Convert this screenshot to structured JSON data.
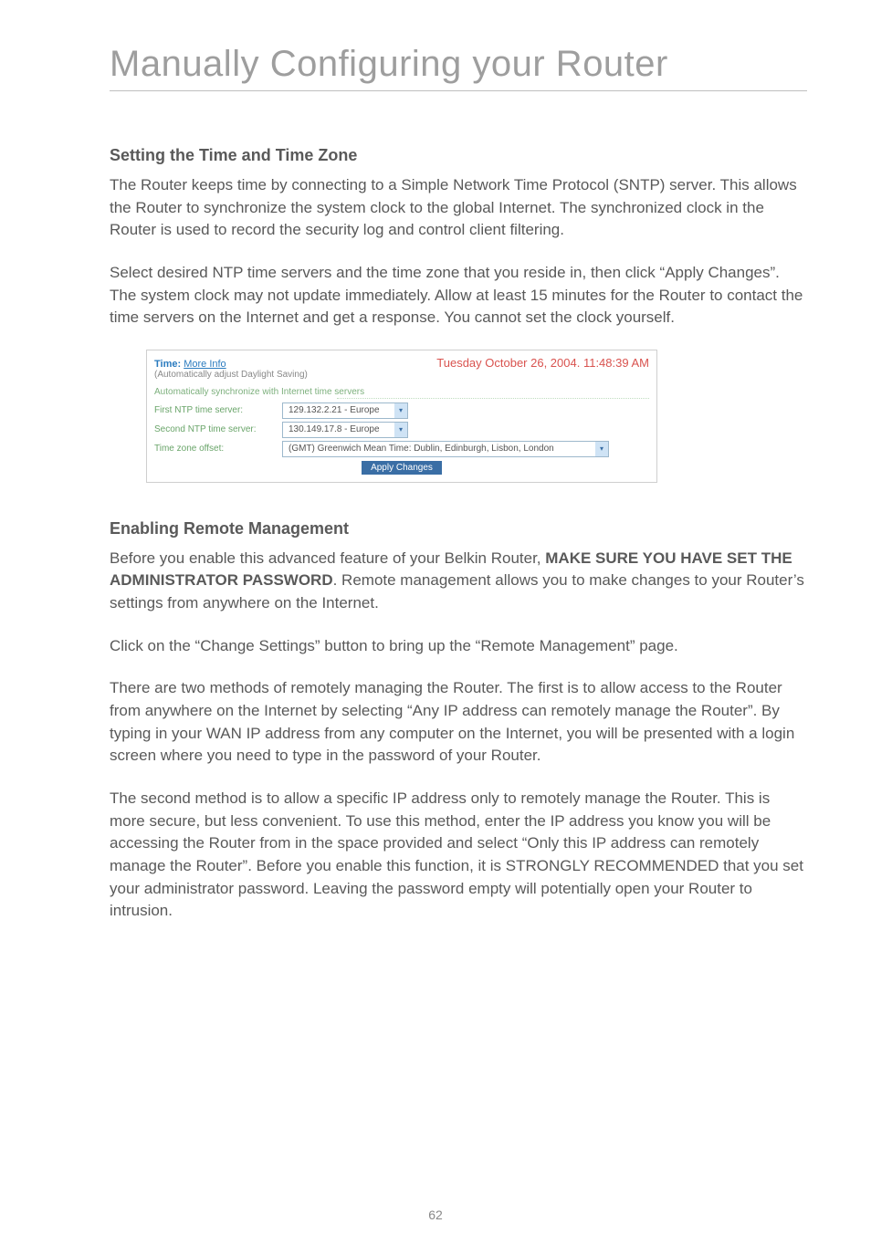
{
  "chapter_title": "Manually Configuring your Router",
  "section1": {
    "heading": "Setting the Time and Time Zone",
    "para1": "The Router keeps time by connecting to a Simple Network Time Protocol (SNTP) server. This allows the Router to synchronize the system clock to the global Internet. The synchronized clock in the Router is used to record the security log and control client filtering.",
    "para2": "Select desired NTP time servers and the time zone that you reside in, then click “Apply Changes”. The system clock may not update immediately. Allow at least 15 minutes for the Router to contact the time servers on the Internet and get a response. You cannot set the clock yourself."
  },
  "embed": {
    "time_label": "Time:",
    "more_info": "More Info",
    "adjust_note": "(Automatically adjust Daylight Saving)",
    "clock_text": "Tuesday October 26, 2004. 11:48:39 AM",
    "auto_sync_text": "Automatically synchronize with Internet time servers",
    "first_ntp_label": "First NTP time server:",
    "first_ntp_value": "129.132.2.21 - Europe",
    "second_ntp_label": "Second NTP time server:",
    "second_ntp_value": "130.149.17.8 - Europe",
    "tz_label": "Time zone offset:",
    "tz_value": "(GMT) Greenwich Mean Time: Dublin, Edinburgh, Lisbon, London",
    "apply_label": "Apply Changes"
  },
  "section2": {
    "heading": "Enabling Remote Management",
    "para1_pre": "Before you enable this advanced feature of your Belkin Router, ",
    "para1_bold": "MAKE SURE YOU HAVE SET THE ADMINISTRATOR PASSWORD",
    "para1_post": ". Remote management allows you to make changes to your Router’s settings from anywhere on the Internet.",
    "para2": "Click on the “Change Settings” button to bring up the “Remote Management” page.",
    "para3": "There are two methods of remotely managing the Router. The first is to allow access to the Router from anywhere on the Internet by selecting “Any IP address can remotely manage the Router”. By typing in your WAN IP address from any computer on the Internet, you will be presented with a login screen where you need to type in the password of your Router.",
    "para4": "The second method is to allow a specific IP address only to remotely manage the Router. This is more secure, but less convenient. To use this method, enter the IP address you know you will be accessing the Router from in the space provided and select “Only this IP address can remotely manage the Router”. Before you enable this function, it is STRONGLY RECOMMENDED that you set your administrator password. Leaving the password empty will potentially open your Router to intrusion."
  },
  "page_number": "62"
}
